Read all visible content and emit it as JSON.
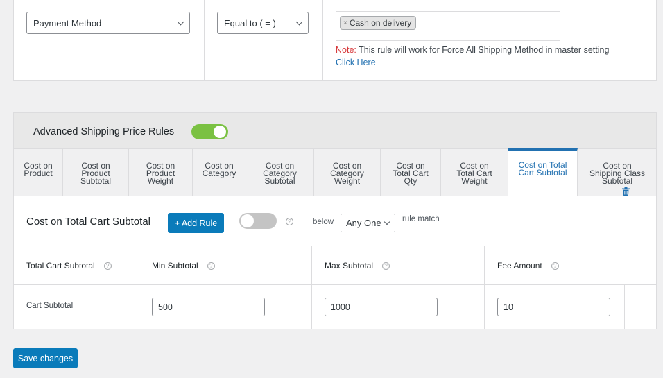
{
  "condition_row": {
    "field_select": {
      "value": "Payment Method"
    },
    "operator_select": {
      "value": "Equal to ( = )"
    },
    "selected_values": [
      {
        "label": "Cash on delivery",
        "remove_glyph": "×"
      }
    ],
    "note": {
      "label": "Note:",
      "text": " This rule will work for Force All Shipping Method in master setting"
    },
    "link_label": "Click Here"
  },
  "advanced": {
    "title": "Advanced Shipping Price Rules",
    "enabled": true,
    "tabs": [
      {
        "label": "Cost on\nProduct",
        "active": false
      },
      {
        "label": "Cost on\nProduct\nSubtotal",
        "active": false
      },
      {
        "label": "Cost on\nProduct\nWeight",
        "active": false
      },
      {
        "label": "Cost on\nCategory",
        "active": false
      },
      {
        "label": "Cost on\nCategory\nSubtotal",
        "active": false
      },
      {
        "label": "Cost on\nCategory\nWeight",
        "active": false
      },
      {
        "label": "Cost on\nTotal Cart\nQty",
        "active": false
      },
      {
        "label": "Cost on\nTotal Cart\nWeight",
        "active": false
      },
      {
        "label": "Cost on Total\nCart Subtotal",
        "active": true
      },
      {
        "label": "Cost on\nShipping Class\nSubtotal",
        "active": false
      }
    ],
    "section": {
      "title": "Cost on Total Cart Subtotal",
      "add_rule_label": "+ Add Rule",
      "match_toggle_enabled": false,
      "help_glyph": "?",
      "below_label": "below",
      "match_select": {
        "value": "Any One"
      },
      "rule_match_label": "rule match"
    },
    "table": {
      "headers": [
        "Total Cart Subtotal",
        "Min Subtotal",
        "Max Subtotal",
        "Fee Amount"
      ],
      "rows": [
        {
          "label": "Cart Subtotal",
          "min": "500",
          "max": "1000",
          "fee": "10"
        }
      ]
    }
  },
  "footer": {
    "save_label": "Save changes"
  },
  "colors": {
    "accent": "#0a7bba",
    "toggle_on": "#7ac142",
    "note": "#d63638",
    "link": "#2271b1"
  }
}
